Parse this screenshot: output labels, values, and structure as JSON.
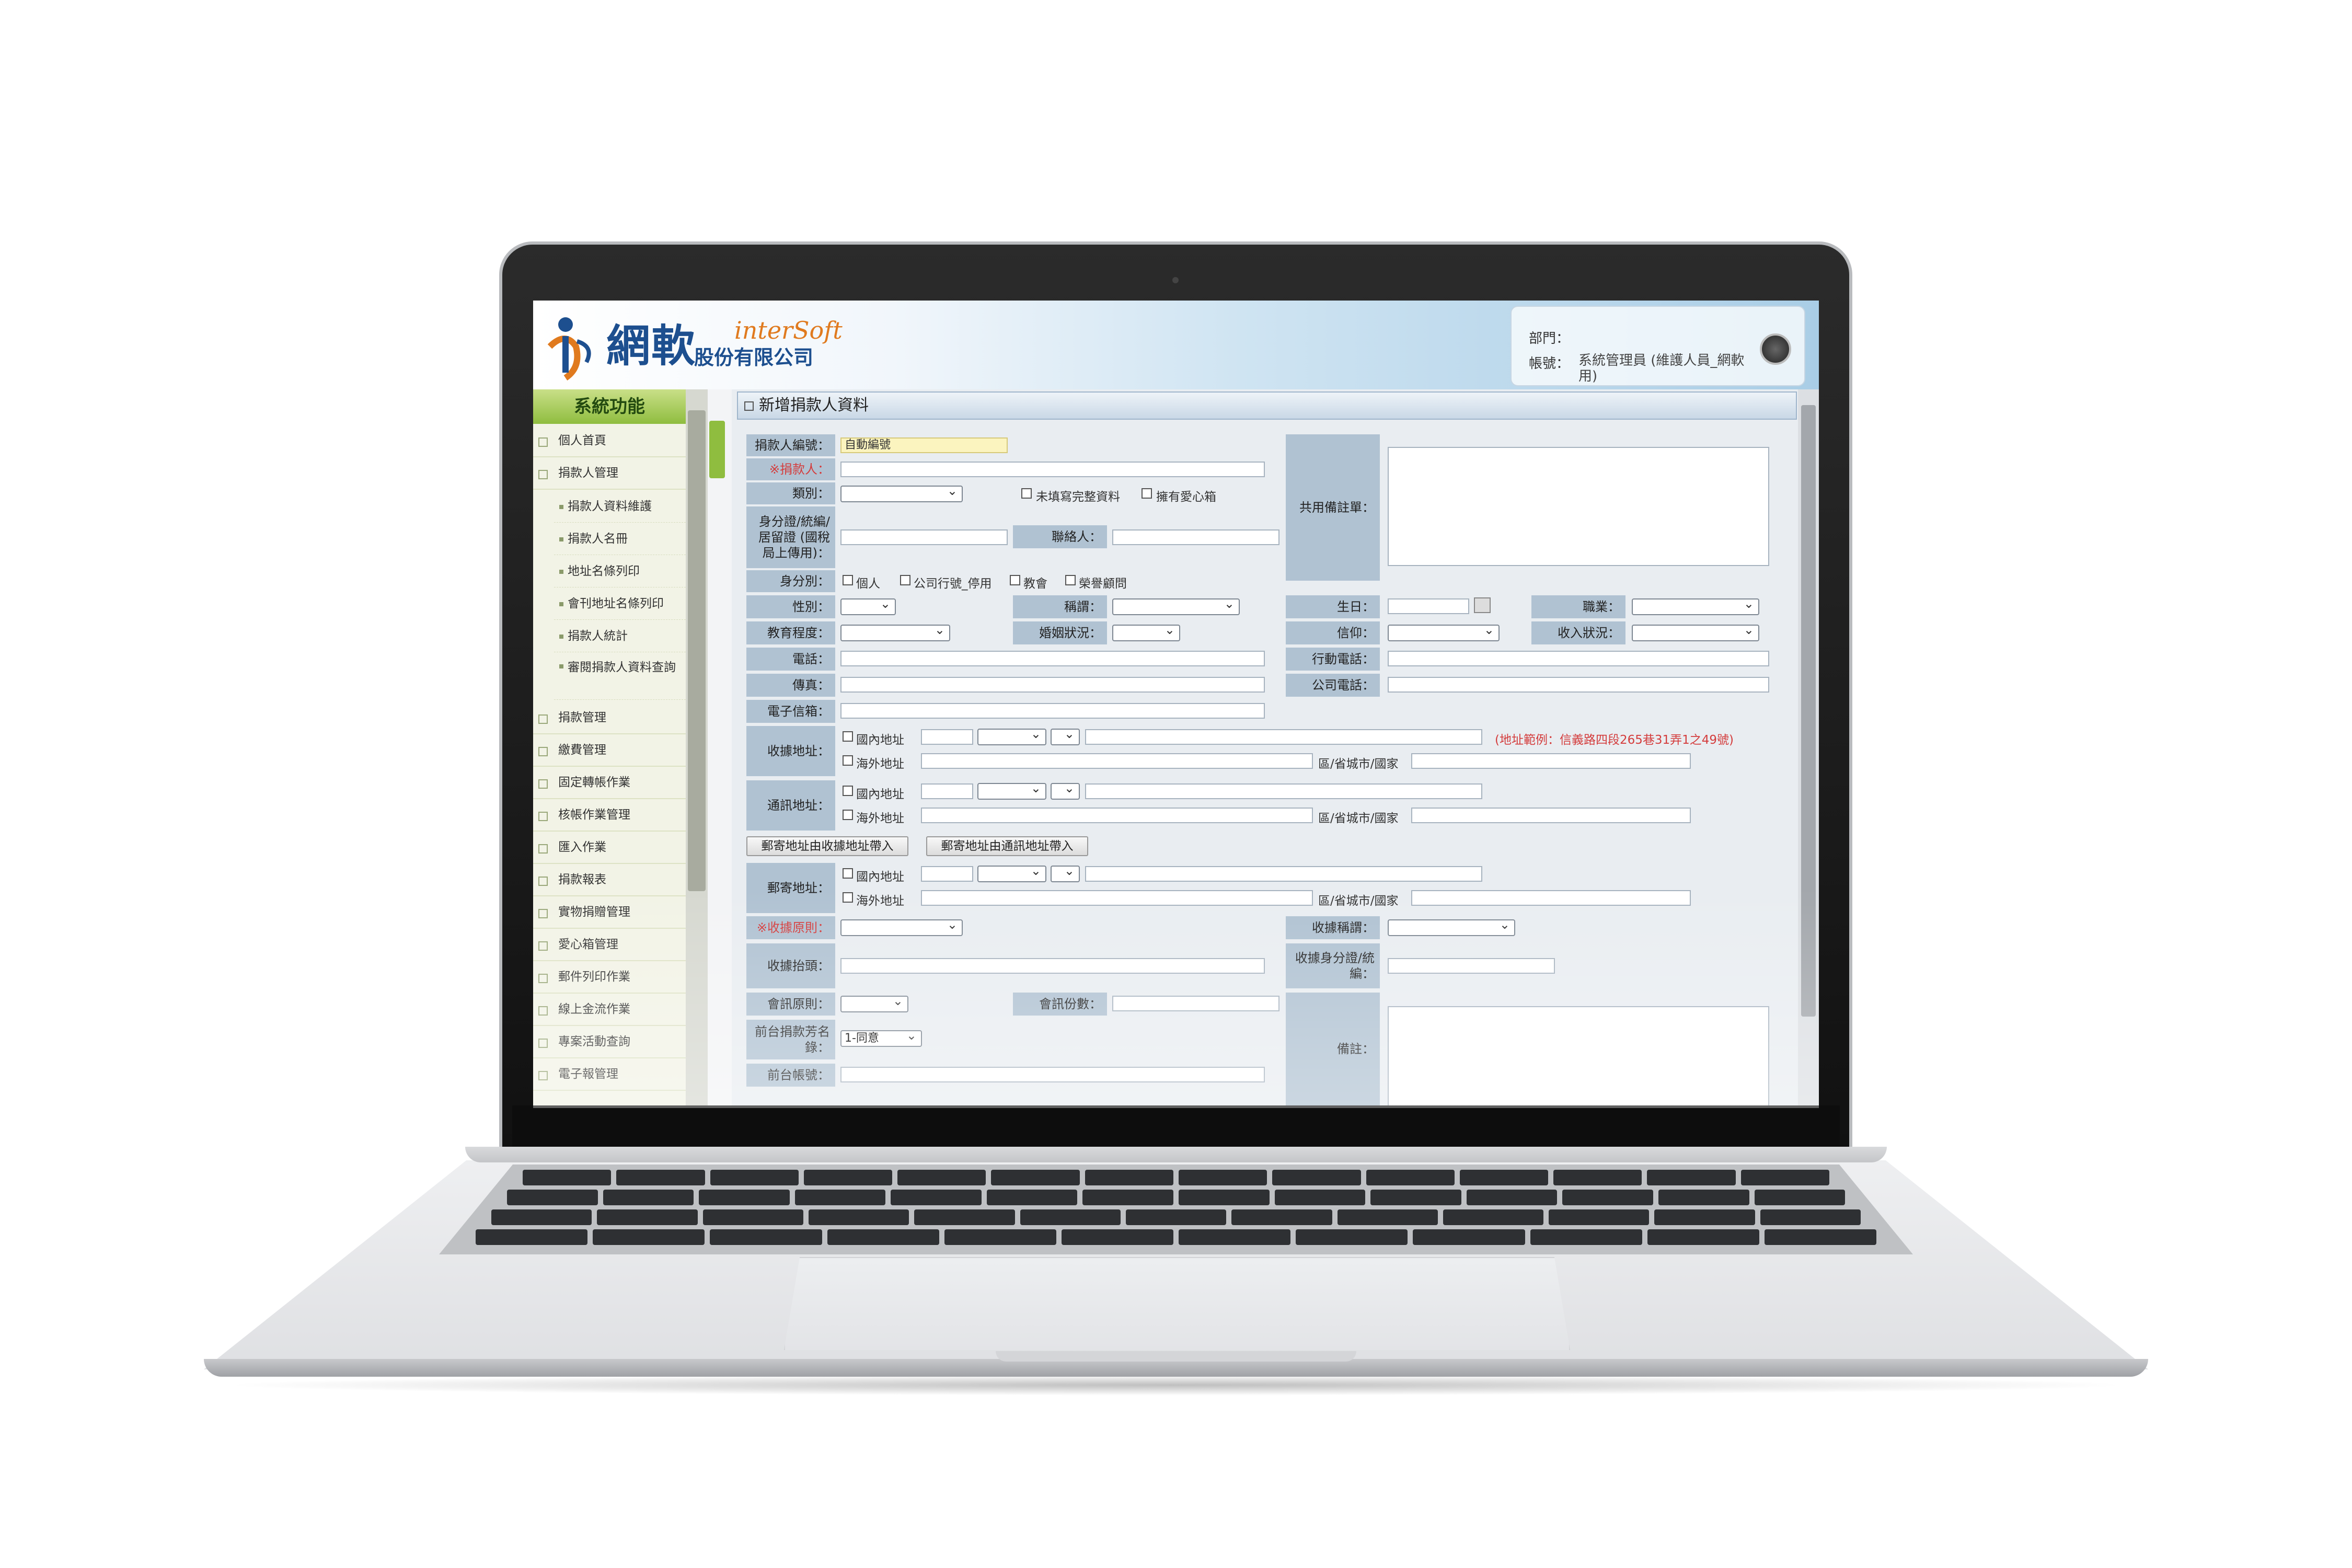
{
  "header": {
    "logo_cn": "網軟",
    "logo_en": "interSoft",
    "logo_sub": "股份有限公司",
    "dept_label": "部門：",
    "dept_value": "",
    "account_label": "帳號：",
    "account_value": "系統管理員 (維護人員_網軟用)"
  },
  "sidebar": {
    "title": "系統功能",
    "items": [
      {
        "label": "個人首頁"
      },
      {
        "label": "捐款人管理"
      },
      {
        "label": "捐款人資料維護"
      },
      {
        "label": "捐款人名冊"
      },
      {
        "label": "地址名條列印"
      },
      {
        "label": "會刊地址名條列印"
      },
      {
        "label": "捐款人統計"
      },
      {
        "label": "審閱捐款人資料查詢"
      },
      {
        "label": "捐款管理"
      },
      {
        "label": "繳費管理"
      },
      {
        "label": "固定轉帳作業"
      },
      {
        "label": "核帳作業管理"
      },
      {
        "label": "匯入作業"
      },
      {
        "label": "捐款報表"
      },
      {
        "label": "實物捐贈管理"
      },
      {
        "label": "愛心箱管理"
      },
      {
        "label": "郵件列印作業"
      },
      {
        "label": "線上金流作業"
      },
      {
        "label": "專案活動查詢"
      },
      {
        "label": "電子報管理"
      }
    ]
  },
  "form": {
    "panel_title": "新增捐款人資料",
    "donor_id_label": "捐款人編號：",
    "donor_id_value": "自動編號",
    "donor_label": "※捐款人：",
    "type_label": "類別：",
    "incomplete_label": "未填寫完整資料",
    "lovebox_label": "擁有愛心箱",
    "shared_note_label": "共用備註單：",
    "id_label": "身分證/統編/居留證 (國稅局上傳用)：",
    "contact_label": "聯絡人：",
    "identity_label": "身分別：",
    "identity_options": [
      "個人",
      "公司行號_停用",
      "教會",
      "榮譽顧問"
    ],
    "gender_label": "性別：",
    "title_label": "稱謂：",
    "birthday_label": "生日：",
    "job_label": "職業：",
    "education_label": "教育程度：",
    "marital_label": "婚姻狀況：",
    "religion_label": "信仰：",
    "income_label": "收入狀況：",
    "phone_label": "電話：",
    "mobile_label": "行動電話：",
    "fax_label": "傳真：",
    "company_phone_label": "公司電話：",
    "email_label": "電子信箱：",
    "receipt_addr_label": "收據地址：",
    "domestic_label": "國內地址",
    "overseas_label": "海外地址",
    "region_label": "區/省城市/國家",
    "addr_example": "(地址範例：信義路四段265巷31弄1之49號)",
    "contact_addr_label": "通訊地址：",
    "btn_copy_receipt": "郵寄地址由收據地址帶入",
    "btn_copy_contact": "郵寄地址由通訊地址帶入",
    "mail_addr_label": "郵寄地址：",
    "receipt_rule_label": "※收據原則：",
    "receipt_title_label": "收據稱謂：",
    "receipt_header_label": "收據抬頭：",
    "receipt_id_label": "收據身分證/統編：",
    "journal_rule_label": "會訊原則：",
    "journal_copies_label": "會訊份數：",
    "frontend_name_label": "前台捐款芳名錄：",
    "frontend_name_value": "1-同意",
    "note_label": "備註：",
    "frontend_account_label": "前台帳號："
  },
  "colors": {
    "label_bg": "#b0c2d2",
    "sidebar_title": "#8fbd3f",
    "required_red": "#d43c3c",
    "auto_field": "#fbf4bf"
  }
}
